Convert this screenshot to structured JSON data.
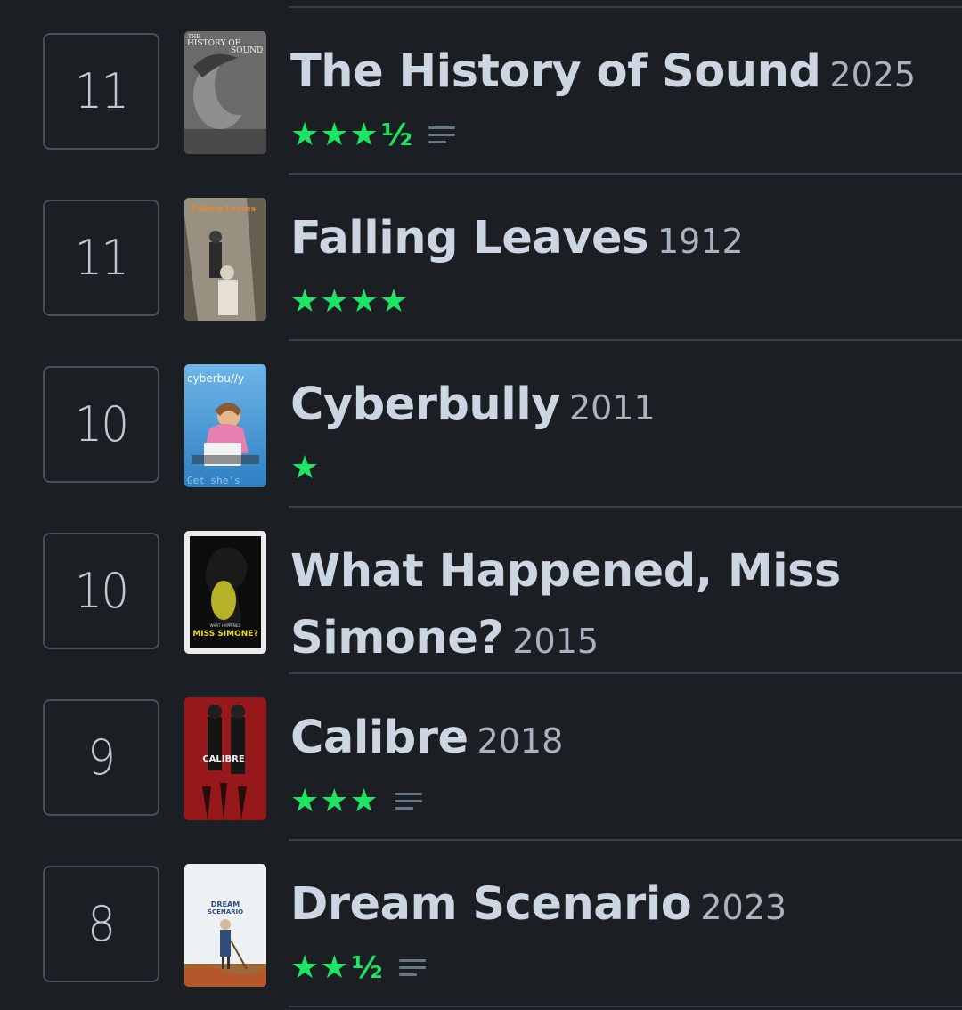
{
  "entries": [
    {
      "rank": "11",
      "title": "The History of Sound",
      "year": "2025",
      "stars": "★★★",
      "half": "½",
      "has_review": true,
      "poster_text": [
        "THE",
        "HISTORY OF",
        "SOUND"
      ]
    },
    {
      "rank": "11",
      "title": "Falling Leaves",
      "year": "1912",
      "stars": "★★★★",
      "half": "",
      "has_review": false,
      "poster_text": [
        "Falling Leaves"
      ]
    },
    {
      "rank": "10",
      "title": "Cyberbully",
      "year": "2011",
      "stars": "★",
      "half": "",
      "has_review": false,
      "poster_text": [
        "cyberbu//y",
        "Get she's"
      ]
    },
    {
      "rank": "10",
      "title": "What Happened, Miss Simone?",
      "title_line1": "What Happened, Miss",
      "title_line2": "Simone?",
      "year": "2015",
      "stars": "",
      "half": "",
      "has_review": false,
      "poster_text": [
        "WHAT HAPPENED",
        "MISS SIMONE?"
      ]
    },
    {
      "rank": "9",
      "title": "Calibre",
      "year": "2018",
      "stars": "★★★",
      "half": "",
      "has_review": true,
      "poster_text": [
        "CALIBRE"
      ]
    },
    {
      "rank": "8",
      "title": "Dream Scenario",
      "year": "2023",
      "stars": "★★",
      "half": "½",
      "has_review": true,
      "poster_text": [
        "DREAM",
        "SCENARIO"
      ]
    }
  ],
  "colors": {
    "background": "#1b1e23",
    "title": "#ccd6e2",
    "year": "#a9b3bf",
    "star": "#1ce564",
    "divider": "#34404e",
    "review_icon": "#687788"
  },
  "icons": {
    "star": "star-icon",
    "half_star": "half-star-icon",
    "review": "review-lines-icon"
  }
}
